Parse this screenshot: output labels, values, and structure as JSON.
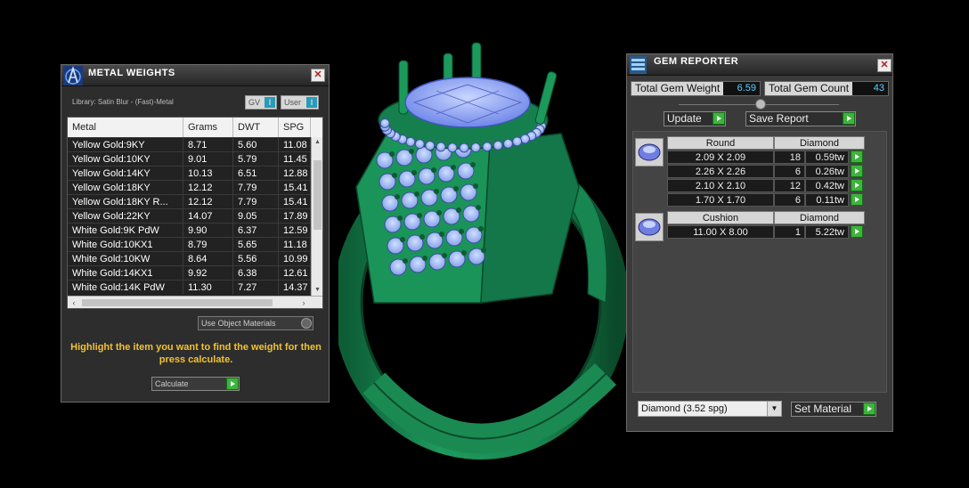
{
  "metal_weights": {
    "title": "METAL WEIGHTS",
    "close": "✕",
    "library": "Library: Satin Blur - (Fast)-Metal",
    "toggle_gv": "GV",
    "toggle_user": "User",
    "toggle_knob": "I",
    "columns": [
      "Metal",
      "Grams",
      "DWT",
      "SPG"
    ],
    "rows": [
      [
        "Yellow Gold:9KY",
        "8.71",
        "5.60",
        "11.08"
      ],
      [
        "Yellow Gold:10KY",
        "9.01",
        "5.79",
        "11.45"
      ],
      [
        "Yellow Gold:14KY",
        "10.13",
        "6.51",
        "12.88"
      ],
      [
        "Yellow Gold:18KY",
        "12.12",
        "7.79",
        "15.41"
      ],
      [
        "Yellow Gold:18KY R...",
        "12.12",
        "7.79",
        "15.41"
      ],
      [
        "Yellow Gold:22KY",
        "14.07",
        "9.05",
        "17.89"
      ],
      [
        "White Gold:9K PdW",
        "9.90",
        "6.37",
        "12.59"
      ],
      [
        "White Gold:10KX1",
        "8.79",
        "5.65",
        "11.18"
      ],
      [
        "White Gold:10KW",
        "8.64",
        "5.56",
        "10.99"
      ],
      [
        "White Gold:14KX1",
        "9.92",
        "6.38",
        "12.61"
      ],
      [
        "White Gold:14K PdW",
        "11.30",
        "7.27",
        "14.37"
      ]
    ],
    "use_object_materials": "Use Object Materials",
    "hint": "Highlight the item you want to find the weight for then press calculate.",
    "calculate": "Calculate"
  },
  "gem_reporter": {
    "title": "GEM REPORTER",
    "close": "✕",
    "total_weight_label": "Total Gem Weight",
    "total_weight_value": "6.59",
    "total_count_label": "Total Gem Count",
    "total_count_value": "43",
    "update": "Update",
    "save_report": "Save Report",
    "groups": [
      {
        "shape": "Round",
        "material": "Diamond",
        "rows": [
          [
            "2.09 X 2.09",
            "18",
            "0.59tw"
          ],
          [
            "2.26 X 2.26",
            "6",
            "0.26tw"
          ],
          [
            "2.10 X 2.10",
            "12",
            "0.42tw"
          ],
          [
            "1.70 X 1.70",
            "6",
            "0.11tw"
          ]
        ]
      },
      {
        "shape": "Cushion",
        "material": "Diamond",
        "rows": [
          [
            "11.00 X 8.00",
            "1",
            "5.22tw"
          ]
        ]
      }
    ],
    "material_select": "Diamond     (3.52 spg)",
    "set_material": "Set Material"
  },
  "colors": {
    "ring_green": "#1f8a55",
    "gem_blue": "#8fa8ff",
    "hint_yellow": "#f1c232",
    "value_cyan": "#5fd0ff"
  }
}
